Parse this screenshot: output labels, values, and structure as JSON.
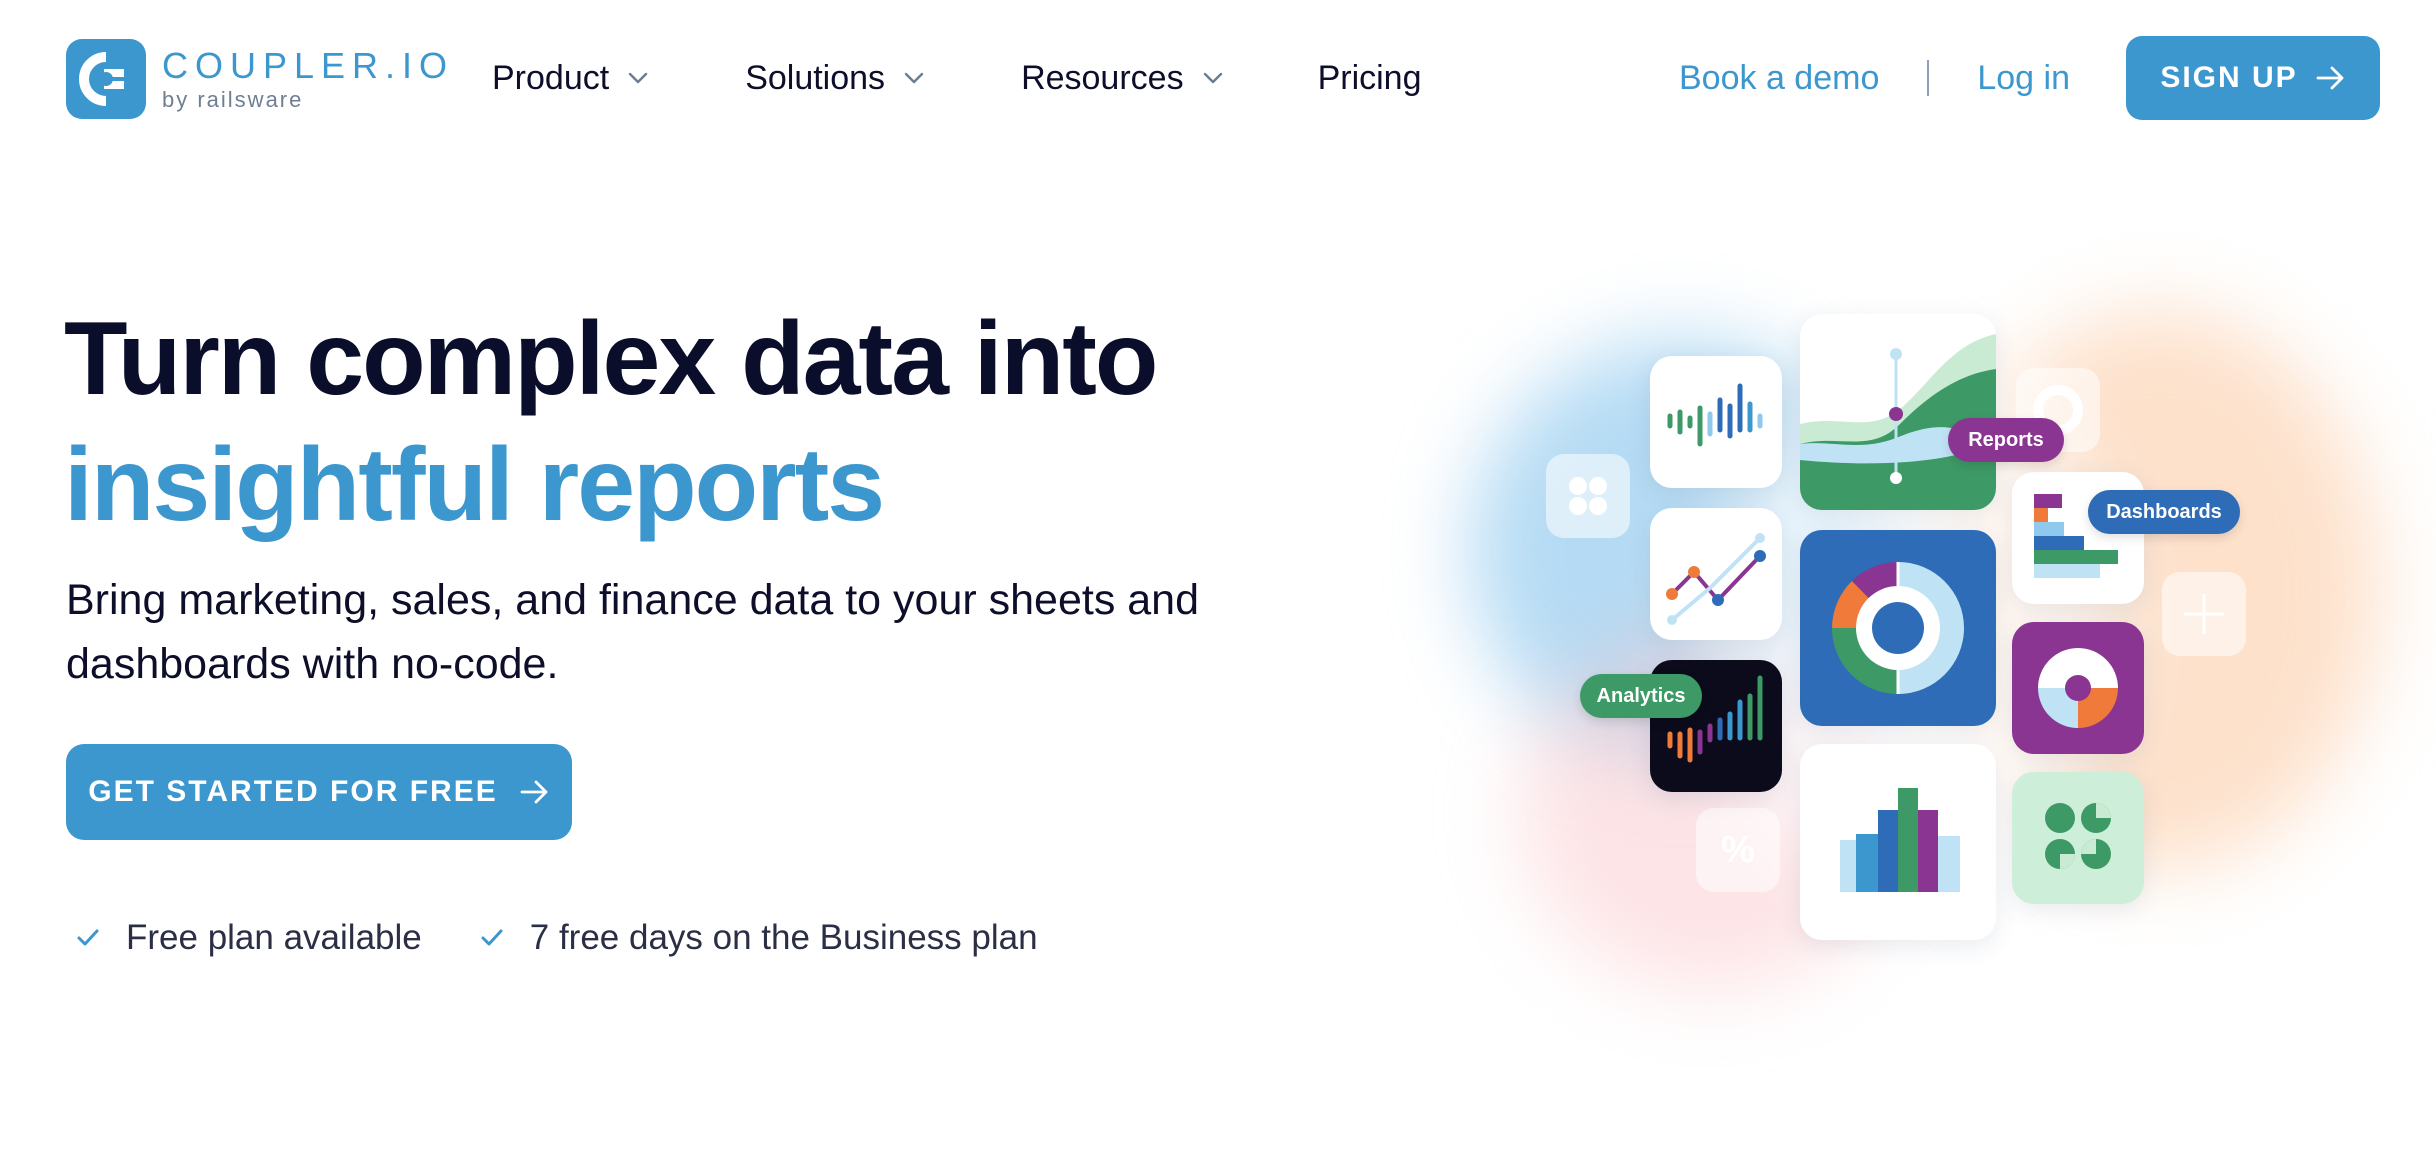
{
  "header": {
    "logo": {
      "name": "COUPLER.IO",
      "sub": "by railsware",
      "icon": "coupler-logo-icon"
    },
    "nav": [
      {
        "label": "Product",
        "has_dropdown": true
      },
      {
        "label": "Solutions",
        "has_dropdown": true
      },
      {
        "label": "Resources",
        "has_dropdown": true
      },
      {
        "label": "Pricing",
        "has_dropdown": false
      }
    ],
    "book_demo": "Book a demo",
    "login": "Log in",
    "signup": "SIGN UP"
  },
  "hero": {
    "title_line1": "Turn complex data into",
    "title_line2": "insightful reports",
    "subtitle": "Bring marketing, sales, and finance data to your sheets and dashboards with no-code.",
    "cta": "GET STARTED FOR FREE",
    "checks": [
      "Free plan available",
      "7 free days on the Business plan"
    ]
  },
  "illustration": {
    "badges": {
      "reports": "Reports",
      "dashboards": "Dashboards",
      "analytics": "Analytics"
    },
    "percent_symbol": "%"
  },
  "colors": {
    "brand_blue": "#3d97cf",
    "heading_dark": "#0a0e2b",
    "purple": "#8a3591",
    "green": "#3d9a66",
    "orange": "#ef7a3a",
    "dark_blue": "#2e6cb7"
  }
}
